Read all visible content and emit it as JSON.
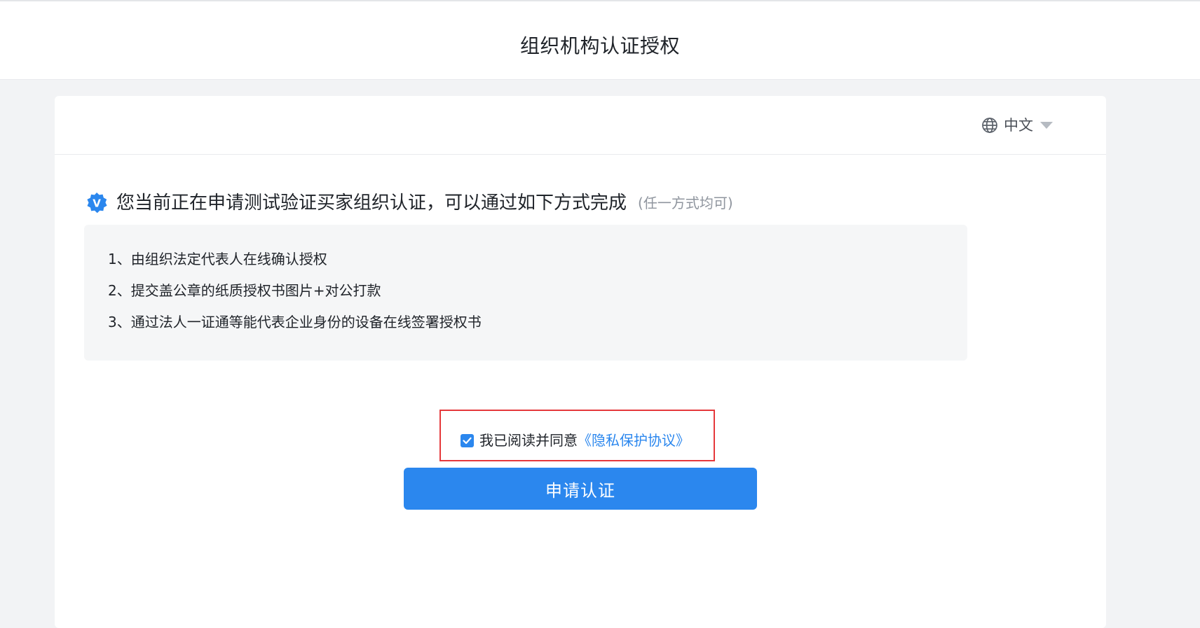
{
  "header": {
    "title": "组织机构认证授权"
  },
  "language": {
    "current": "中文",
    "icon": "globe-icon"
  },
  "intro": {
    "badge_icon": "verified-badge-icon",
    "badge_letter": "V",
    "headline": "您当前正在申请测试验证买家组织认证，可以通过如下方式完成",
    "note": "(任一方式均可)"
  },
  "methods": [
    "1、由组织法定代表人在线确认授权",
    "2、提交盖公章的纸质授权书图片+对公打款",
    "3、通过法人一证通等能代表企业身份的设备在线签署授权书"
  ],
  "agreement": {
    "checked": true,
    "text": "我已阅读并同意",
    "link_text": "《隐私保护协议》"
  },
  "submit": {
    "label": "申请认证"
  },
  "colors": {
    "primary": "#2b87ee",
    "highlight_border": "#e5383b",
    "page_bg": "#f2f3f5",
    "box_bg": "#f5f6f7"
  }
}
